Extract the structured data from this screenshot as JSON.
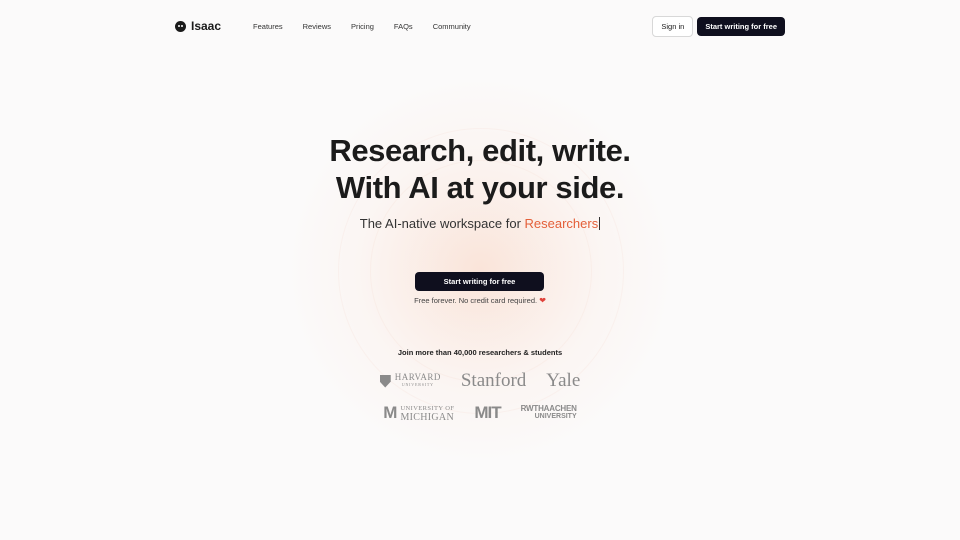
{
  "nav": {
    "brand": "Isaac",
    "links": [
      "Features",
      "Reviews",
      "Pricing",
      "FAQs",
      "Community"
    ],
    "sign_in": "Sign in",
    "cta": "Start writing for free"
  },
  "hero": {
    "title_line1": "Research, edit, write.",
    "title_line2": "With AI at your side.",
    "subtitle_prefix": "The AI-native workspace for ",
    "subtitle_accent": "Researchers",
    "cta": "Start writing for free",
    "note": "Free forever. No credit card required.",
    "note_icon": "heart-icon"
  },
  "social_proof": {
    "heading": "Join more than 40,000 researchers & students",
    "logos": [
      {
        "name": "harvard",
        "line1": "HARVARD",
        "line2": "UNIVERSITY"
      },
      {
        "name": "stanford",
        "text": "Stanford"
      },
      {
        "name": "yale",
        "text": "Yale"
      },
      {
        "name": "michigan",
        "line1": "UNIVERSITY OF",
        "line2": "MICHIGAN",
        "mark": "M"
      },
      {
        "name": "mit",
        "text": "MIT"
      },
      {
        "name": "rwth",
        "line1": "RWTHAACHEN",
        "line2": "UNIVERSITY"
      }
    ]
  },
  "colors": {
    "accent": "#e4603a",
    "dark_button": "#0f0f1e",
    "background": "#fbfafa",
    "logo_gray": "#8a8a8a"
  }
}
